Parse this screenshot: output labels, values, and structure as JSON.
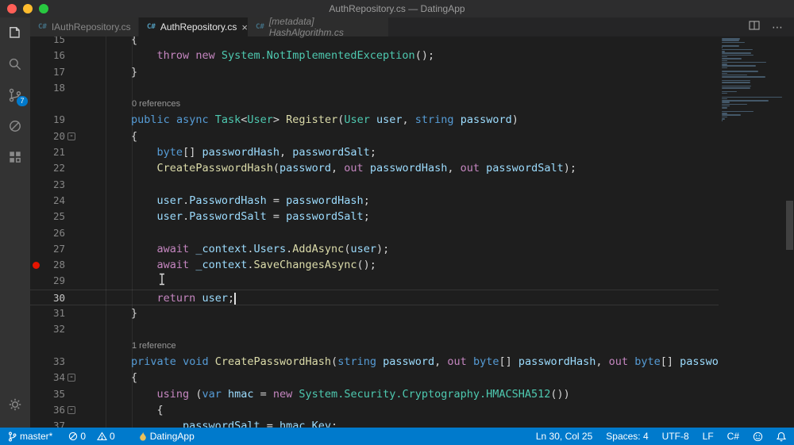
{
  "title_bar": {
    "title": "AuthRepository.cs — DatingApp"
  },
  "activity_bar": {
    "scm_badge": "7"
  },
  "tab_bar": {
    "tabs": [
      {
        "icon": "C#",
        "label": "IAuthRepository.cs"
      },
      {
        "icon": "C#",
        "label": "AuthRepository.cs"
      },
      {
        "icon": "C#",
        "label": "[metadata] HashAlgorithm.cs"
      }
    ],
    "close_glyph": "×",
    "more_actions_glyph": "⋯"
  },
  "editor": {
    "fold_glyph": "-",
    "rows": [
      {
        "n": "15",
        "tokens": [
          [
            "p",
            "        {"
          ]
        ]
      },
      {
        "n": "16",
        "tokens": [
          [
            "p",
            "            "
          ],
          [
            "c",
            "throw"
          ],
          [
            "p",
            " "
          ],
          [
            "c",
            "new"
          ],
          [
            "p",
            " "
          ],
          [
            "t",
            "System.NotImplementedException"
          ],
          [
            "p",
            "();"
          ]
        ]
      },
      {
        "n": "17",
        "tokens": [
          [
            "p",
            "        }"
          ]
        ]
      },
      {
        "n": "18",
        "tokens": []
      },
      {
        "lens": true,
        "text": "0 references"
      },
      {
        "n": "19",
        "tokens": [
          [
            "p",
            "        "
          ],
          [
            "k",
            "public"
          ],
          [
            "p",
            " "
          ],
          [
            "k",
            "async"
          ],
          [
            "p",
            " "
          ],
          [
            "t",
            "Task"
          ],
          [
            "p",
            "<"
          ],
          [
            "t",
            "User"
          ],
          [
            "p",
            "> "
          ],
          [
            "m",
            "Register"
          ],
          [
            "p",
            "("
          ],
          [
            "t",
            "User"
          ],
          [
            "p",
            " "
          ],
          [
            "v",
            "user"
          ],
          [
            "p",
            ", "
          ],
          [
            "k",
            "string"
          ],
          [
            "p",
            " "
          ],
          [
            "v",
            "password"
          ],
          [
            "p",
            ")"
          ]
        ]
      },
      {
        "n": "20",
        "fold": true,
        "tokens": [
          [
            "p",
            "        {"
          ]
        ]
      },
      {
        "n": "21",
        "tokens": [
          [
            "p",
            "            "
          ],
          [
            "k",
            "byte"
          ],
          [
            "p",
            "[] "
          ],
          [
            "v",
            "passwordHash"
          ],
          [
            "p",
            ", "
          ],
          [
            "v",
            "passwordSalt"
          ],
          [
            "p",
            ";"
          ]
        ]
      },
      {
        "n": "22",
        "tokens": [
          [
            "p",
            "            "
          ],
          [
            "m",
            "CreatePasswordHash"
          ],
          [
            "p",
            "("
          ],
          [
            "v",
            "password"
          ],
          [
            "p",
            ", "
          ],
          [
            "c",
            "out"
          ],
          [
            "p",
            " "
          ],
          [
            "v",
            "passwordHash"
          ],
          [
            "p",
            ", "
          ],
          [
            "c",
            "out"
          ],
          [
            "p",
            " "
          ],
          [
            "v",
            "passwordSalt"
          ],
          [
            "p",
            ");"
          ]
        ]
      },
      {
        "n": "23",
        "tokens": []
      },
      {
        "n": "24",
        "tokens": [
          [
            "p",
            "            "
          ],
          [
            "v",
            "user"
          ],
          [
            "p",
            "."
          ],
          [
            "v",
            "PasswordHash"
          ],
          [
            "p",
            " = "
          ],
          [
            "v",
            "passwordHash"
          ],
          [
            "p",
            ";"
          ]
        ]
      },
      {
        "n": "25",
        "tokens": [
          [
            "p",
            "            "
          ],
          [
            "v",
            "user"
          ],
          [
            "p",
            "."
          ],
          [
            "v",
            "PasswordSalt"
          ],
          [
            "p",
            " = "
          ],
          [
            "v",
            "passwordSalt"
          ],
          [
            "p",
            ";"
          ]
        ]
      },
      {
        "n": "26",
        "tokens": []
      },
      {
        "n": "27",
        "tokens": [
          [
            "p",
            "            "
          ],
          [
            "c",
            "await"
          ],
          [
            "p",
            " "
          ],
          [
            "v",
            "_context"
          ],
          [
            "p",
            "."
          ],
          [
            "v",
            "Users"
          ],
          [
            "p",
            "."
          ],
          [
            "m",
            "AddAsync"
          ],
          [
            "p",
            "("
          ],
          [
            "v",
            "user"
          ],
          [
            "p",
            ");"
          ]
        ]
      },
      {
        "n": "28",
        "breakpoint": true,
        "tokens": [
          [
            "p",
            "            "
          ],
          [
            "c",
            "await"
          ],
          [
            "p",
            " "
          ],
          [
            "v",
            "_context"
          ],
          [
            "p",
            "."
          ],
          [
            "m",
            "SaveChangesAsync"
          ],
          [
            "p",
            "();"
          ]
        ]
      },
      {
        "n": "29",
        "tokens": []
      },
      {
        "n": "30",
        "current": true,
        "tokens": [
          [
            "p",
            "            "
          ],
          [
            "c",
            "return"
          ],
          [
            "p",
            " "
          ],
          [
            "v",
            "user"
          ],
          [
            "p",
            ";"
          ]
        ]
      },
      {
        "n": "31",
        "tokens": [
          [
            "p",
            "        }"
          ]
        ]
      },
      {
        "n": "32",
        "tokens": []
      },
      {
        "lens": true,
        "text": "1 reference"
      },
      {
        "n": "33",
        "tokens": [
          [
            "p",
            "        "
          ],
          [
            "k",
            "private"
          ],
          [
            "p",
            " "
          ],
          [
            "k",
            "void"
          ],
          [
            "p",
            " "
          ],
          [
            "m",
            "CreatePasswordHash"
          ],
          [
            "p",
            "("
          ],
          [
            "k",
            "string"
          ],
          [
            "p",
            " "
          ],
          [
            "v",
            "password"
          ],
          [
            "p",
            ", "
          ],
          [
            "c",
            "out"
          ],
          [
            "p",
            " "
          ],
          [
            "k",
            "byte"
          ],
          [
            "p",
            "[] "
          ],
          [
            "v",
            "passwordHash"
          ],
          [
            "p",
            ", "
          ],
          [
            "c",
            "out"
          ],
          [
            "p",
            " "
          ],
          [
            "k",
            "byte"
          ],
          [
            "p",
            "[] "
          ],
          [
            "v",
            "passwordSalt"
          ],
          [
            "p",
            ")"
          ]
        ]
      },
      {
        "n": "34",
        "fold": true,
        "tokens": [
          [
            "p",
            "        {"
          ]
        ]
      },
      {
        "n": "35",
        "tokens": [
          [
            "p",
            "            "
          ],
          [
            "c",
            "using"
          ],
          [
            "p",
            " ("
          ],
          [
            "k",
            "var"
          ],
          [
            "p",
            " "
          ],
          [
            "v",
            "hmac"
          ],
          [
            "p",
            " = "
          ],
          [
            "c",
            "new"
          ],
          [
            "p",
            " "
          ],
          [
            "t",
            "System.Security.Cryptography.HMACSHA512"
          ],
          [
            "p",
            "())"
          ]
        ]
      },
      {
        "n": "36",
        "fold": true,
        "tokens": [
          [
            "p",
            "            {"
          ]
        ]
      },
      {
        "n": "37",
        "tokens": [
          [
            "p",
            "                "
          ],
          [
            "v",
            "passwordSalt"
          ],
          [
            "p",
            " = "
          ],
          [
            "v",
            "hmac"
          ],
          [
            "p",
            "."
          ],
          [
            "v",
            "Key"
          ],
          [
            "p",
            ";"
          ]
        ]
      }
    ]
  },
  "minimap_lines": [
    29,
    27,
    36,
    0,
    28,
    1,
    49,
    5,
    46,
    50,
    9,
    31,
    9,
    70,
    9,
    54,
    9,
    0,
    57,
    9,
    40,
    69,
    0,
    45,
    45,
    0,
    46,
    45,
    0,
    24,
    9,
    0,
    95,
    9,
    74,
    13,
    40,
    13,
    9,
    0,
    50,
    9,
    30,
    9,
    5,
    1
  ],
  "status_bar": {
    "branch": "master*",
    "errors": "0",
    "warnings": "0",
    "project": "DatingApp",
    "line_col": "Ln 30, Col 25",
    "spaces": "Spaces: 4",
    "encoding": "UTF-8",
    "eol": "LF",
    "language": "C#"
  }
}
